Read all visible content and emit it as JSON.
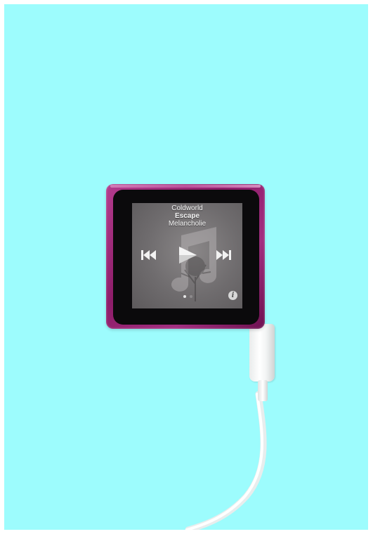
{
  "scene": {
    "background_color": "#9dfcfd",
    "device_color": "#9c2b7d"
  },
  "now_playing": {
    "artist": "Coldworld",
    "title": "Escape",
    "album": "Melancholie"
  },
  "controls": {
    "previous_icon": "previous-track-icon",
    "play_icon": "play-icon",
    "next_icon": "next-track-icon",
    "info_label": "i"
  },
  "pagination": {
    "current_page": 1,
    "total_pages": 2
  }
}
